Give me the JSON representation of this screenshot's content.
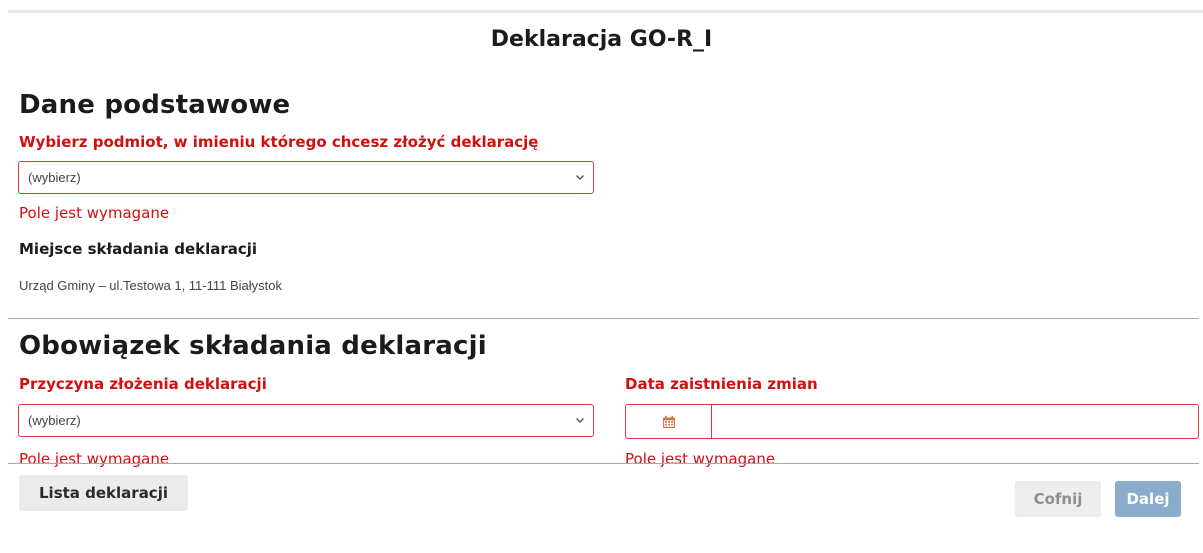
{
  "page": {
    "title": "Deklaracja GO-R_I"
  },
  "basic": {
    "heading": "Dane podstawowe",
    "entity_label": "Wybierz podmiot, w imieniu którego chcesz złożyć deklarację",
    "entity_select_value": "(wybierz)",
    "entity_error": "Pole jest wymagane",
    "place_label": "Miejsce składania deklaracji",
    "place_value": "Urząd Gminy – ul.Testowa 1, 11-111 Białystok"
  },
  "obligation": {
    "heading": "Obowiązek składania deklaracji",
    "reason_label": "Przyczyna złożenia deklaracji",
    "reason_select_value": "(wybierz)",
    "reason_error": "Pole jest wymagane",
    "date_label": "Data zaistnienia zmian",
    "date_value": "",
    "date_error": "Pole jest wymagane",
    "date_icon": "calendar-icon"
  },
  "footer": {
    "list_button": "Lista deklaracji",
    "back_button": "Cofnij",
    "next_button": "Dalej"
  },
  "colors": {
    "required": "#d10f0f",
    "error_border": "#dd3a3a",
    "primary_disabled": "#8aabc9",
    "secondary_bg": "#ebebeb"
  }
}
